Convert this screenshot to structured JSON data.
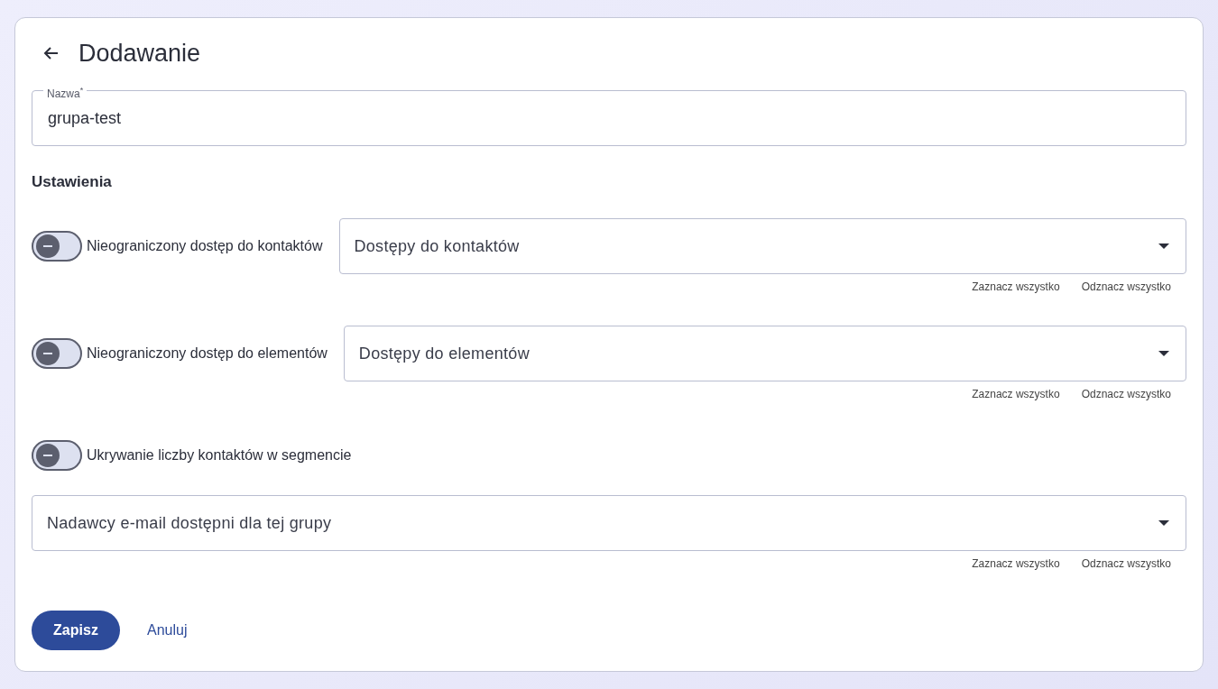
{
  "header": {
    "title": "Dodawanie"
  },
  "name_field": {
    "label": "Nazwa",
    "required_mark": "*",
    "value": "grupa-test"
  },
  "settings": {
    "title": "Ustawienia",
    "rows": [
      {
        "kind": "toggle-select",
        "label": "Nieograniczony dostęp do kontaktów",
        "on": false,
        "placeholder": "Dostępy do kontaktów",
        "actions": [
          "Zaznacz wszystko",
          "Odznacz wszystko"
        ]
      },
      {
        "kind": "toggle-select",
        "label": "Nieograniczony dostęp do elementów",
        "on": false,
        "placeholder": "Dostępy do elementów",
        "actions": [
          "Zaznacz wszystko",
          "Odznacz wszystko"
        ]
      },
      {
        "kind": "toggle",
        "label": "Ukrywanie liczby kontaktów w segmencie",
        "on": false
      },
      {
        "kind": "select",
        "placeholder": "Nadawcy e-mail dostępni dla tej grupy",
        "actions": [
          "Zaznacz wszystko",
          "Odznacz wszystko"
        ]
      }
    ]
  },
  "buttons": {
    "save": "Zapisz",
    "cancel": "Anuluj"
  }
}
